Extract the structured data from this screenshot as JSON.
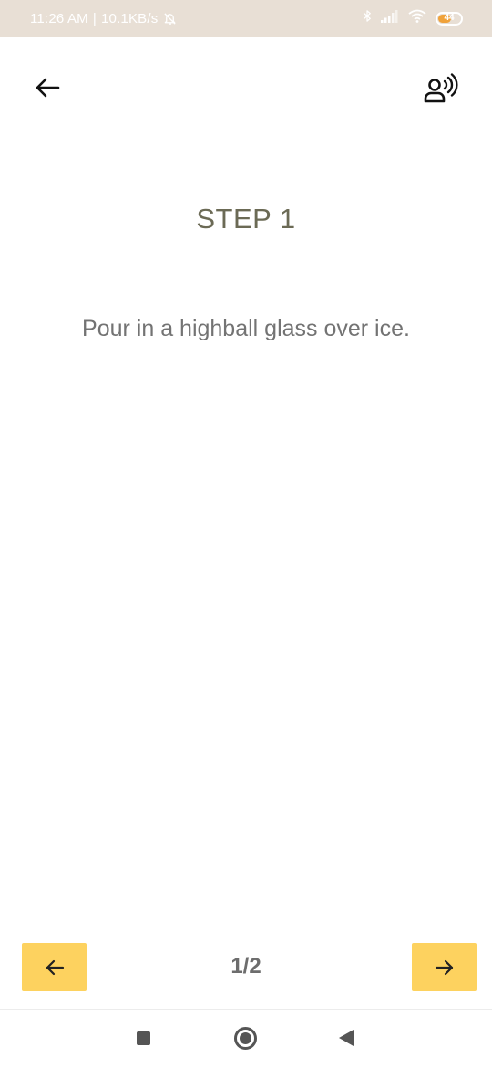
{
  "status_bar": {
    "time": "11:26 AM",
    "separator": "|",
    "network_speed": "10.1KB/s",
    "battery_level": "44",
    "icons": [
      "bell-off-icon",
      "bluetooth-icon",
      "signal-icon",
      "wifi-icon",
      "battery-icon"
    ]
  },
  "header": {
    "back_icon": "arrow-left-icon",
    "voice_icon": "voice-speaker-icon"
  },
  "step": {
    "title": "STEP 1",
    "instruction": "Pour in a highball glass over ice."
  },
  "pager": {
    "indicator": "1/2",
    "prev_icon": "arrow-left-icon",
    "next_icon": "arrow-right-icon"
  },
  "system_nav": {
    "icons": [
      "recents-square-icon",
      "home-circle-icon",
      "back-triangle-icon"
    ]
  },
  "colors": {
    "status_bar": "#e8dfd5",
    "title": "#6b6a55",
    "body_text": "#737373",
    "accent_button": "#fdd25f",
    "battery": "#f0a23a"
  }
}
